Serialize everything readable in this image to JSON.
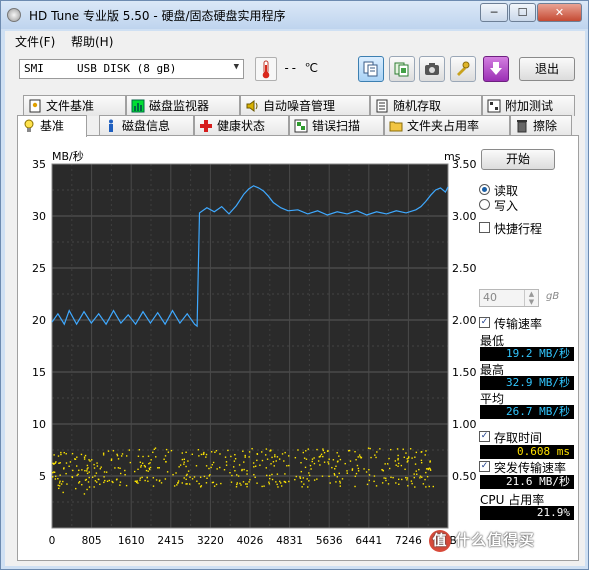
{
  "window": {
    "title": "HD Tune 专业版 5.50 - 硬盘/固态硬盘实用程序"
  },
  "menu": {
    "file": "文件(F)",
    "help": "帮助(H)"
  },
  "toolbar": {
    "drive": "SMI     USB DISK (8 gB)",
    "temperature": "-- ℃",
    "exit_label": "退出",
    "buttons": [
      "copy-icon",
      "save-icon",
      "camera-icon",
      "tools-icon",
      "download-icon"
    ]
  },
  "tabs": {
    "top": [
      "文件基准",
      "磁盘监视器",
      "自动噪音管理",
      "随机存取",
      "附加测试"
    ],
    "bottom": [
      "基准",
      "磁盘信息",
      "健康状态",
      "错误扫描",
      "文件夹占用率",
      "擦除"
    ],
    "selected": "基准"
  },
  "side": {
    "start_label": "开始",
    "read_label": "读取",
    "write_label": "写入",
    "read_selected": true,
    "short_stroke_label": "快捷行程",
    "short_stroke_checked": false,
    "short_stroke_value": "40",
    "short_stroke_unit": "gB",
    "transfer_rate_label": "传输速率",
    "transfer_rate_checked": true,
    "min_label": "最低",
    "min_value": "19.2 MB/秒",
    "max_label": "最高",
    "max_value": "32.9 MB/秒",
    "avg_label": "平均",
    "avg_value": "26.7 MB/秒",
    "access_time_label": "存取时间",
    "access_time_checked": true,
    "access_time_value": "0.608 ms",
    "burst_label": "突发传输速率",
    "burst_checked": true,
    "burst_value": "21.6 MB/秒",
    "cpu_label": "CPU 占用率",
    "cpu_value": "21.9%"
  },
  "chart_data": {
    "type": "line",
    "y_left_label": "MB/秒",
    "y_right_label": "ms",
    "x_unit": "mB",
    "ylim": [
      0,
      35
    ],
    "y2lim": [
      0,
      3.5
    ],
    "xlim": [
      0,
      8052
    ],
    "y_ticks": [
      5,
      10,
      15,
      20,
      25,
      30,
      35
    ],
    "y2_ticks": [
      "0.50",
      "1.00",
      "1.50",
      "2.00",
      "2.50",
      "3.00",
      "3.50"
    ],
    "x_ticks": [
      "0",
      "805",
      "1610",
      "2415",
      "3220",
      "4026",
      "4831",
      "5636",
      "6441",
      "7246",
      "mB"
    ],
    "grid": true,
    "background": "#2a2a2a",
    "series": [
      {
        "color": "#3fa9ff",
        "x": [
          0,
          120,
          250,
          350,
          500,
          650,
          800,
          950,
          1100,
          1250,
          1400,
          1550,
          1700,
          1850,
          2000,
          2150,
          2300,
          2450,
          2600,
          2750,
          2900,
          2950,
          3000,
          3150,
          3300,
          3450,
          3600,
          3750,
          3900,
          4000,
          4100,
          4200,
          4300,
          4400,
          4500,
          4650,
          4800,
          5000,
          5200,
          5400,
          5600,
          5800,
          6000,
          6200,
          6400,
          6600,
          6800,
          7000,
          7200,
          7400,
          7500,
          7600,
          7700,
          7800,
          7900,
          8000,
          8052
        ],
        "y": [
          19.8,
          20.6,
          19.6,
          20.9,
          19.6,
          20.8,
          19.7,
          20.6,
          19.6,
          20.9,
          19.7,
          20.5,
          19.6,
          20.8,
          19.7,
          20.7,
          19.6,
          20.9,
          19.7,
          20.6,
          19.6,
          19.4,
          30.3,
          30.8,
          30.4,
          30.9,
          30.2,
          31.0,
          32.1,
          32.6,
          32.9,
          32.7,
          32.4,
          31.9,
          31.3,
          30.8,
          30.5,
          30.6,
          30.2,
          30.5,
          30.1,
          30.4,
          30.2,
          30.5,
          30.1,
          30.4,
          30.2,
          30.5,
          30.3,
          30.6,
          30.9,
          31.4,
          32.0,
          32.5,
          32.7,
          32.3,
          32.8
        ]
      }
    ]
  },
  "watermark": {
    "text": "什么值得买",
    "badge": "值"
  }
}
